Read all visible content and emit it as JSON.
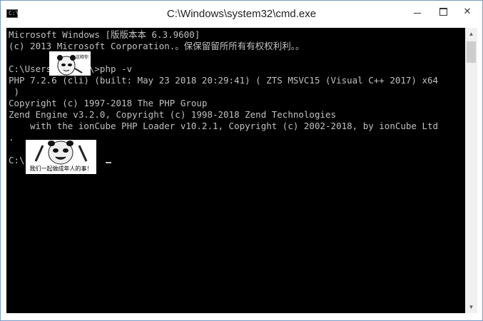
{
  "window": {
    "title": "C:\\Windows\\system32\\cmd.exe",
    "icon_prompt": "C:\\"
  },
  "controls": {
    "minimize_icon": "minimize-icon",
    "maximize_icon": "maximize-icon",
    "close_icon": "close-icon",
    "close_glyph": "✕"
  },
  "console": {
    "lines": [
      "Microsoft Windows [版版本本 6.3.9600]",
      "(c) 2013 Microsoft Corporation.。保保留留所所有有权权利利。。",
      "",
      "C:\\Users\\      \\>php -v",
      "PHP 7.2.6 (cli) (built: May 23 2018 20:29:41) ( ZTS MSVC15 (Visual C++ 2017) x64",
      " )",
      "Copyright (c) 1997-2018 The PHP Group",
      "Zend Engine v3.2.0, Copyright (c) 1998-2018 Zend Technologies",
      "    with the ionCube PHP Loader v10.2.1, Copyright (c) 2002-2018, by ionCube Ltd",
      ".",
      "",
      "C:\\           a"
    ]
  },
  "stickers": {
    "small_caption": "这释你",
    "big_caption": "我们一起做成年人的事！"
  },
  "colors": {
    "console_bg": "#000000",
    "console_fg": "#c0c0c0",
    "frame_border": "#7a9cc6"
  }
}
